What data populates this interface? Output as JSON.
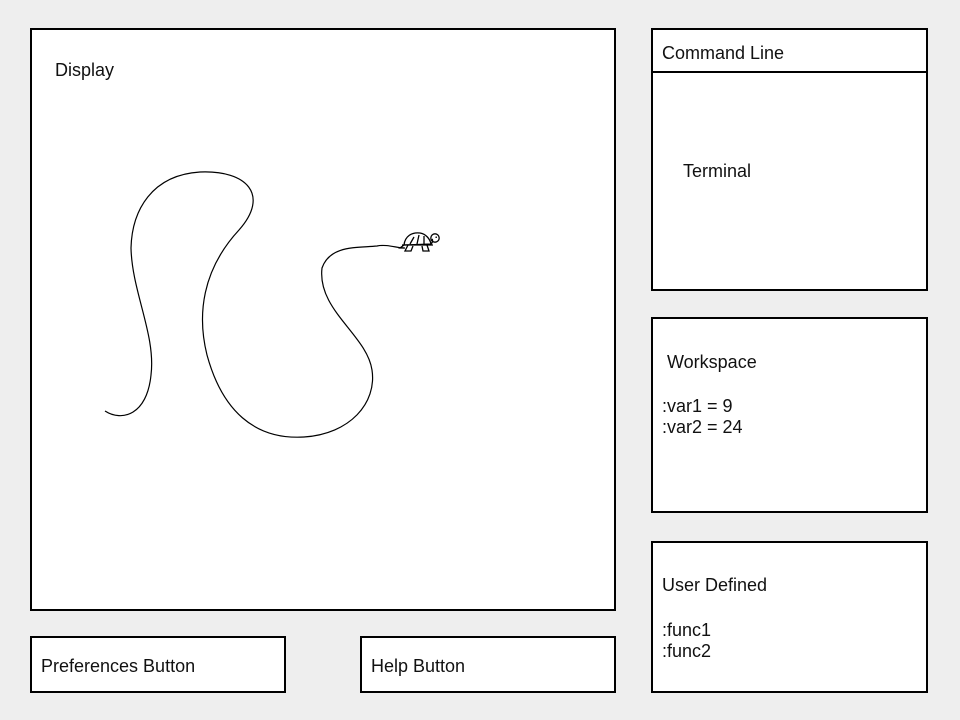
{
  "display": {
    "title": "Display"
  },
  "command_line": {
    "title": "Command Line",
    "terminal_label": "Terminal"
  },
  "workspace": {
    "title": "Workspace",
    "variables": [
      ":var1 = 9",
      ":var2 = 24"
    ]
  },
  "user_defined": {
    "title": "User Defined",
    "functions": [
      ":func1",
      ":func2"
    ]
  },
  "buttons": {
    "preferences_label": "Preferences Button",
    "help_label": "Help Button"
  },
  "icons": {
    "turtle": "turtle-icon"
  }
}
